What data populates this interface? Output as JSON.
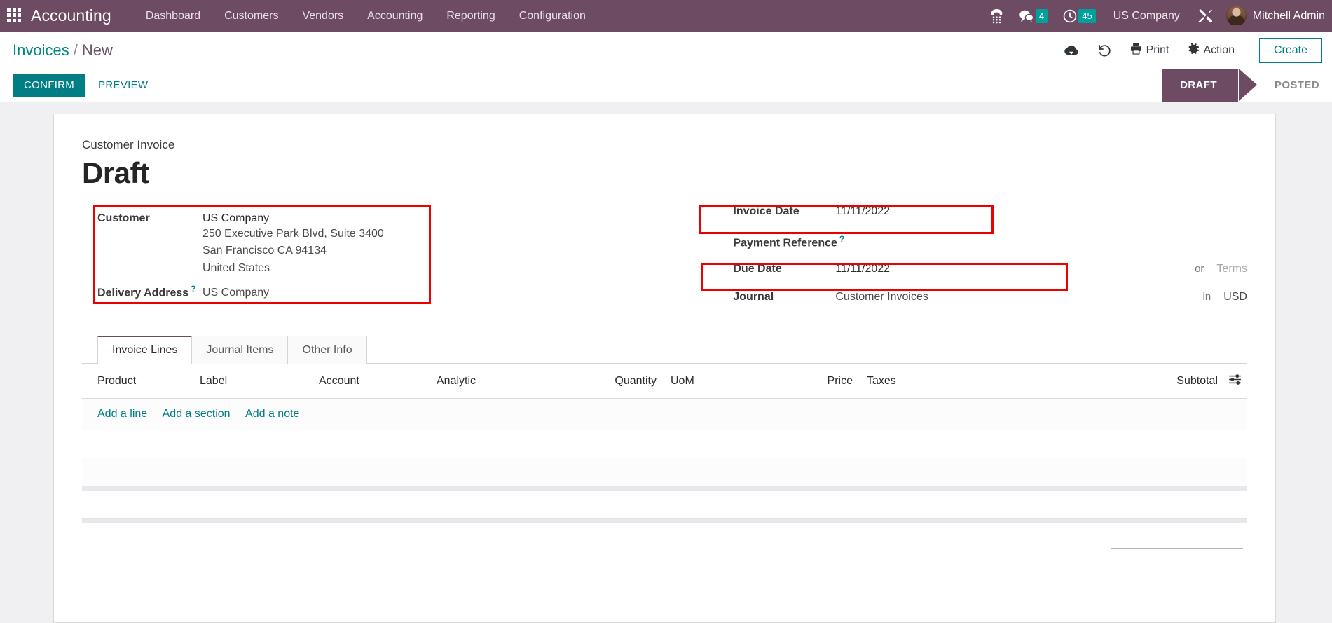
{
  "navbar": {
    "apps_icon": "apps-grid-icon",
    "brand": "Accounting",
    "menu": [
      {
        "label": "Dashboard"
      },
      {
        "label": "Customers"
      },
      {
        "label": "Vendors"
      },
      {
        "label": "Accounting"
      },
      {
        "label": "Reporting"
      },
      {
        "label": "Configuration"
      }
    ],
    "voip_icon": "phone-dialpad-icon",
    "messages_icon": "chat-bubble-icon",
    "messages_count": "4",
    "activities_icon": "clock-icon",
    "activities_count": "45",
    "company": "US Company",
    "debug_icon": "tools-icon",
    "avatar_icon": "user-avatar",
    "user": "Mitchell Admin",
    "accent_bg": "#6d4c63",
    "badge_color": "#00a09d"
  },
  "control_panel": {
    "breadcrumb_root": "Invoices",
    "breadcrumb_sep": "/",
    "breadcrumb_current": "New",
    "save_icon": "cloud-upload-icon",
    "discard_icon": "undo-icon",
    "print_icon": "printer-icon",
    "print_label": "Print",
    "action_icon": "gear-icon",
    "action_label": "Action",
    "create_label": "Create",
    "confirm_label": "CONFIRM",
    "preview_label": "PREVIEW",
    "statuses": [
      {
        "label": "DRAFT",
        "active": true
      },
      {
        "label": "POSTED",
        "active": false
      }
    ],
    "accent_teal": "#017e84"
  },
  "form": {
    "doc_subtitle": "Customer Invoice",
    "doc_title": "Draft",
    "customer_label": "Customer",
    "customer_value": "US Company",
    "customer_address": [
      "250 Executive Park Blvd, Suite 3400",
      "San Francisco CA 94134",
      "United States"
    ],
    "delivery_address_label": "Delivery Address",
    "delivery_address_help": "?",
    "delivery_address_value": "US Company",
    "invoice_date_label": "Invoice Date",
    "invoice_date_value": "11/11/2022",
    "payment_reference_label": "Payment Reference",
    "payment_reference_help": "?",
    "payment_reference_value": "",
    "due_date_label": "Due Date",
    "due_date_value": "11/11/2022",
    "due_date_or": "or",
    "due_date_terms_placeholder": "Terms",
    "journal_label": "Journal",
    "journal_value": "Customer Invoices",
    "journal_in": "in",
    "journal_currency": "USD",
    "highlight_color": "#ee0000"
  },
  "notebook": {
    "tabs": [
      {
        "label": "Invoice Lines",
        "active": true
      },
      {
        "label": "Journal Items",
        "active": false
      },
      {
        "label": "Other Info",
        "active": false
      }
    ],
    "columns": [
      "Product",
      "Label",
      "Account",
      "Analytic",
      "Quantity",
      "UoM",
      "Price",
      "Taxes",
      "Subtotal"
    ],
    "optional_columns_icon": "sliders-icon",
    "rows": [],
    "add_line_label": "Add a line",
    "add_section_label": "Add a section",
    "add_note_label": "Add a note"
  }
}
